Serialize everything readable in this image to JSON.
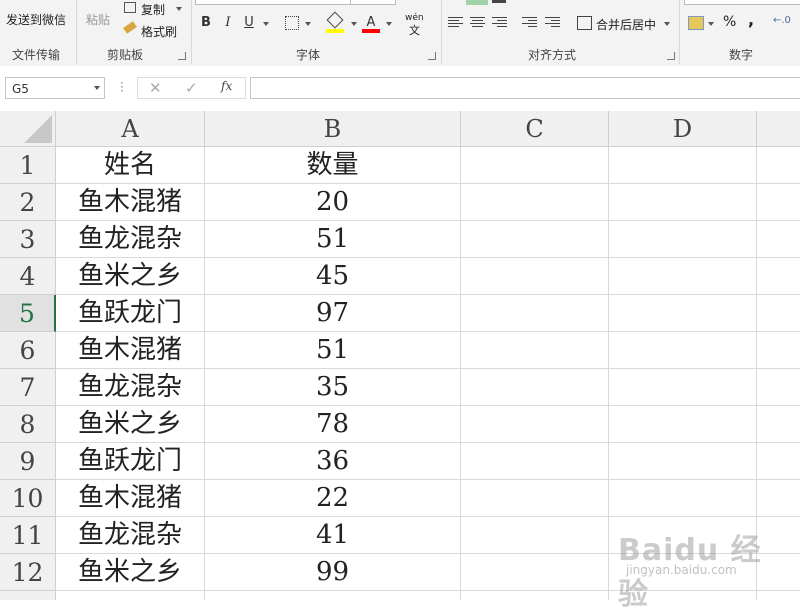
{
  "ribbon": {
    "groups": {
      "file_transfer": "文件传输",
      "clipboard": "剪贴板",
      "font": "字体",
      "alignment": "对齐方式",
      "number": "数字"
    },
    "send_to_wechat": "发送到微信",
    "paste": "粘贴",
    "copy": "复制",
    "format_painter": "格式刷",
    "bold": "B",
    "italic": "I",
    "underline": "U",
    "font_color_glyph": "A",
    "fill_color": "#FFFF00",
    "font_color": "#FF0000",
    "phonetic": "wén",
    "phonetic_char": "文",
    "merge_center": "合并后居中",
    "percent": "%",
    "comma": ","
  },
  "formula_bar": {
    "name_box": "G5",
    "fx": "fx"
  },
  "sheet": {
    "columns": [
      "A",
      "B",
      "C",
      "D"
    ],
    "selected_row": 5,
    "rows": [
      {
        "n": "1",
        "a": "姓名",
        "b": "数量"
      },
      {
        "n": "2",
        "a": "鱼木混猪",
        "b": "20"
      },
      {
        "n": "3",
        "a": "鱼龙混杂",
        "b": "51"
      },
      {
        "n": "4",
        "a": "鱼米之乡",
        "b": "45"
      },
      {
        "n": "5",
        "a": "鱼跃龙门",
        "b": "97"
      },
      {
        "n": "6",
        "a": "鱼木混猪",
        "b": "51"
      },
      {
        "n": "7",
        "a": "鱼龙混杂",
        "b": "35"
      },
      {
        "n": "8",
        "a": "鱼米之乡",
        "b": "78"
      },
      {
        "n": "9",
        "a": "鱼跃龙门",
        "b": "36"
      },
      {
        "n": "10",
        "a": "鱼木混猪",
        "b": "22"
      },
      {
        "n": "11",
        "a": "鱼龙混杂",
        "b": "41"
      },
      {
        "n": "12",
        "a": "鱼米之乡",
        "b": "99"
      }
    ]
  },
  "watermark": {
    "brand": "Baidu 经验",
    "url": "jingyan.baidu.com"
  },
  "colors": {
    "excel_green": "#217346",
    "ribbon_bg": "#F3F3F3",
    "header_bg": "#F0F0F0",
    "gridline": "#D9D9D9"
  }
}
